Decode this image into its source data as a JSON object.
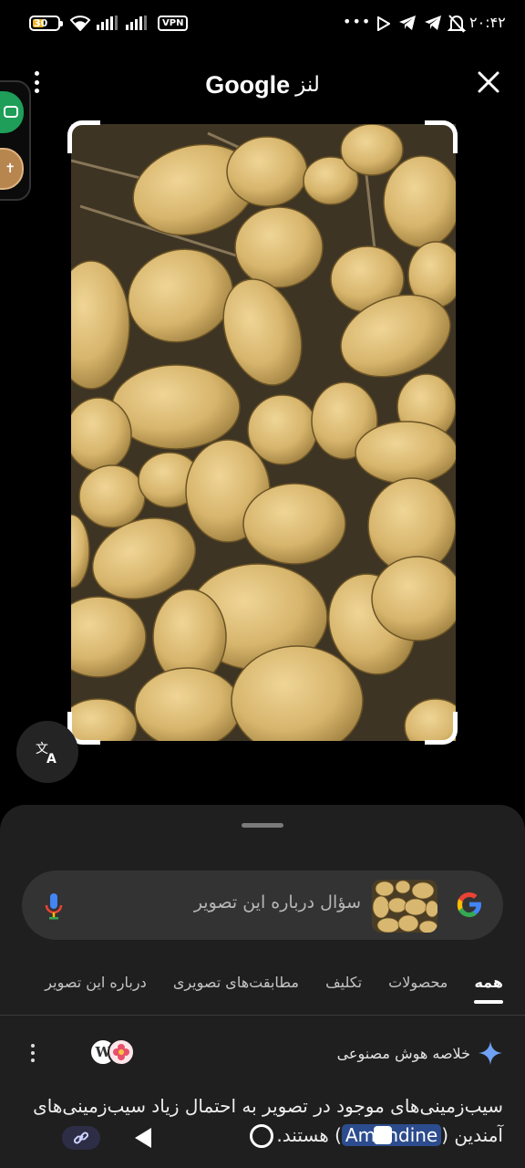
{
  "status_bar": {
    "battery_level": "30",
    "vpn_label": "VPN",
    "overflow": "•••",
    "time": "۲۰:۴۲"
  },
  "header": {
    "title_lens": "لنز",
    "title_google": "Google",
    "menu_icon": "more-vert-icon",
    "close_icon": "close-icon"
  },
  "image": {
    "description_tag": "potatoes-photo",
    "accent_color": "#d9b870"
  },
  "search": {
    "placeholder": "سؤال درباره این تصویر",
    "mic_icon": "mic-icon",
    "logo_icon": "google-g-icon"
  },
  "tabs": [
    {
      "label": "همه",
      "active": true
    },
    {
      "label": "محصولات",
      "active": false
    },
    {
      "label": "تکلیف",
      "active": false
    },
    {
      "label": "مطابقت‌های تصویری",
      "active": false
    },
    {
      "label": "درباره این تصویر",
      "active": false
    }
  ],
  "ai_overview": {
    "title": "خلاصه هوش مصنوعی",
    "source_wp": "W",
    "text_part1": "سیب‌زمینی‌های موجود در تصویر به احتمال زیاد سیب‌زمینی‌های آمندین (",
    "text_highlight": "Amandine",
    "text_part2": ") هستند."
  },
  "colors": {
    "sheet_bg": "#1f1f1f",
    "search_bg": "#333333",
    "highlight_bg": "#2c4c8e"
  }
}
